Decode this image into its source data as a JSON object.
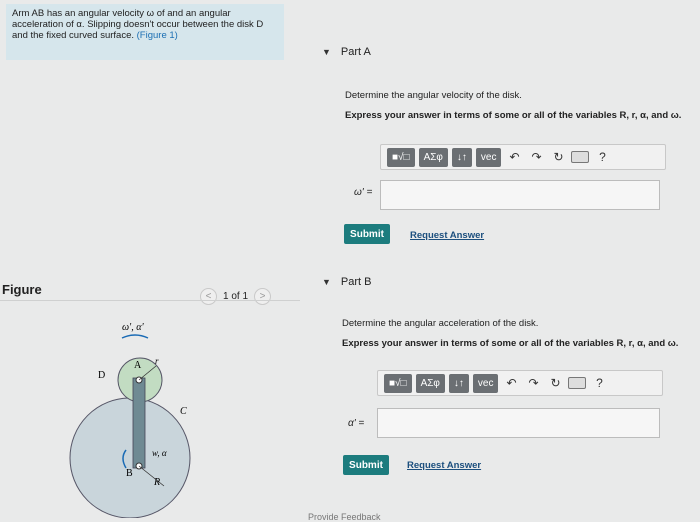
{
  "problem": {
    "text": "Arm AB has an angular velocity ω of and an angular acceleration of α. Slipping doesn't occur between the disk D and the fixed curved surface.",
    "figure_link": "(Figure 1)"
  },
  "figure_panel": {
    "title": "Figure",
    "page_text": "1 of 1",
    "prev": "<",
    "next": ">",
    "labels": {
      "omega_alpha_prime": "ω', α'",
      "D": "D",
      "A": "A",
      "r": "r",
      "C": "C",
      "w_alpha": "w, α",
      "B": "B",
      "R": "R"
    }
  },
  "parts": [
    {
      "title": "Part A",
      "question": "Determine the angular velocity of the disk.",
      "instruction": "Express your answer in terms of some or all of the variables R, r, α, and ω.",
      "answer_label": "ω' =",
      "submit": "Submit",
      "request": "Request Answer"
    },
    {
      "title": "Part B",
      "question": "Determine the angular acceleration of the disk.",
      "instruction": "Express your answer in terms of some or all of the variables R, r, α, and ω.",
      "answer_label": "α' =",
      "submit": "Submit",
      "request": "Request Answer"
    }
  ],
  "toolbar": {
    "template_icon": "template-icon",
    "greek_label": "ΑΣφ",
    "arrows_label": "↓↑",
    "vec_label": "vec",
    "undo_icon": "undo-icon",
    "redo_icon": "redo-icon",
    "reset_icon": "reset-icon",
    "keyboard_icon": "keyboard-icon",
    "help_label": "?"
  },
  "footer": {
    "feedback": "Provide Feedback"
  },
  "colors": {
    "problem_bg": "#d6e6ec",
    "submit_bg": "#1c7c7e",
    "link": "#1c6fb3"
  }
}
